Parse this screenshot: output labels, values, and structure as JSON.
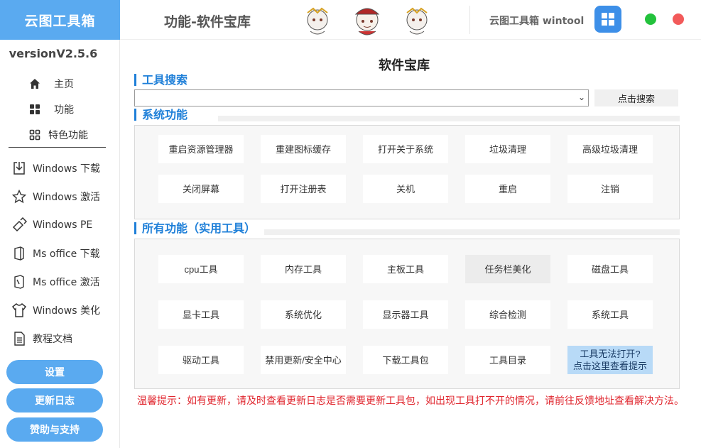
{
  "brand": {
    "name": "云图工具箱"
  },
  "header": {
    "page_title": "功能-软件宝库",
    "app_name": "云图工具箱 wintool"
  },
  "sidebar": {
    "version": "versionV2.5.6",
    "top_items": [
      {
        "label": "主页",
        "icon": "home-icon"
      },
      {
        "label": "功能",
        "icon": "grid-icon"
      },
      {
        "label": "特色功能",
        "icon": "apps-icon"
      }
    ],
    "items": [
      {
        "label": "Windows 下载",
        "icon": "download-icon"
      },
      {
        "label": "Windows 激活",
        "icon": "star-icon"
      },
      {
        "label": "Windows PE",
        "icon": "usb-icon"
      },
      {
        "label": "Ms office 下载",
        "icon": "office-icon"
      },
      {
        "label": "Ms office 激活",
        "icon": "office-key-icon"
      },
      {
        "label": "Windows 美化",
        "icon": "shirt-icon"
      },
      {
        "label": "教程文档",
        "icon": "document-icon"
      }
    ],
    "buttons": {
      "settings": "设置",
      "changelog": "更新日志",
      "sponsor": "赞助与支持"
    }
  },
  "main": {
    "title": "软件宝库",
    "search": {
      "label": "工具搜索",
      "value": "",
      "button": "点击搜索"
    },
    "system": {
      "label": "系统功能",
      "tools": [
        "重启资源管理器",
        "重建图标缓存",
        "打开关于系统",
        "垃圾清理",
        "高级垃圾清理",
        "关闭屏幕",
        "打开注册表",
        "关机",
        "重启",
        "注销"
      ]
    },
    "all": {
      "label": "所有功能（实用工具）",
      "tools": [
        "cpu工具",
        "内存工具",
        "主板工具",
        "任务栏美化",
        "磁盘工具",
        "显卡工具",
        "系统优化",
        "显示器工具",
        "综合检测",
        "系统工具",
        "驱动工具",
        "禁用更新/安全中心",
        "下载工具包",
        "工具目录"
      ],
      "help_line1": "工具无法打开?",
      "help_line2": "点击这里查看提示"
    },
    "warning": "温馨提示：如有更新，请及时查看更新日志是否需要更新工具包，如出现工具打不开的情况，请前往反馈地址查看解决方法。"
  },
  "colors": {
    "accent": "#5aaaf0",
    "section": "#1e7fd8",
    "warning": "#e0262e"
  }
}
